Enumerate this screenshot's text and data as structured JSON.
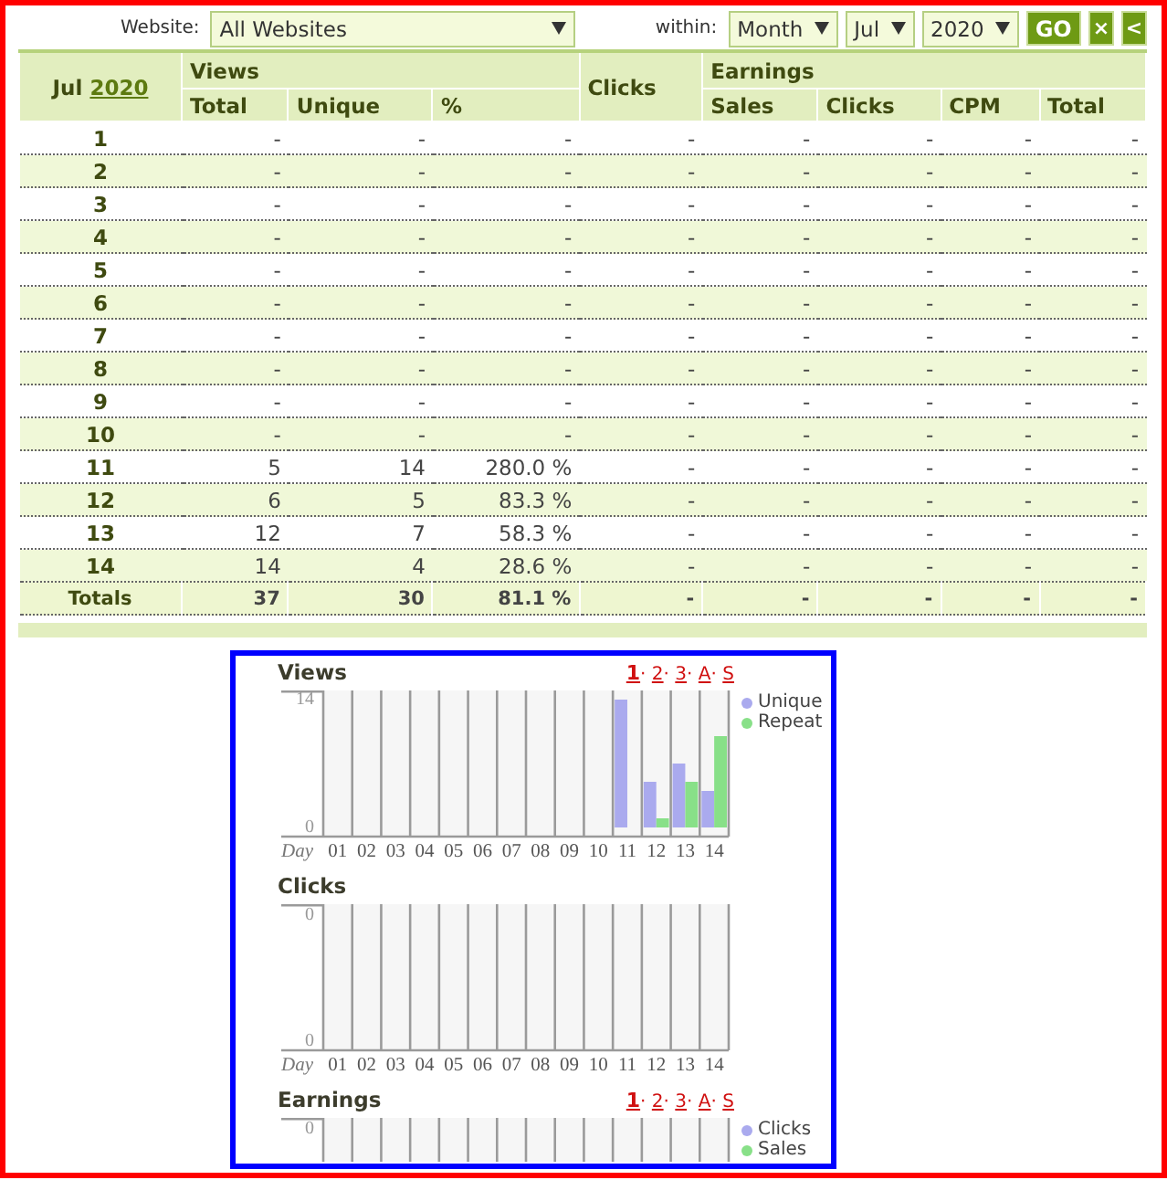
{
  "filters": {
    "website_label": "Website:",
    "website": "All Websites",
    "within_label": "within:",
    "period": "Month",
    "month": "Jul",
    "year": "2020",
    "buttons": [
      {
        "kind": "go",
        "label": "GO"
      },
      {
        "kind": "clear",
        "label": "×"
      },
      {
        "kind": "back",
        "label": "<"
      }
    ]
  },
  "table": {
    "month": "Jul",
    "year": "2020",
    "views": "Views",
    "clicks": "Clicks",
    "earnings": "Earnings",
    "views_columns": [
      "Total",
      "Unique",
      "%"
    ],
    "earnings_columns": [
      "Sales",
      "Clicks",
      "CPM",
      "Total"
    ],
    "rows": [
      {
        "day": "1",
        "cells": [
          "-",
          "-",
          "-",
          "-",
          "-",
          "-",
          "-",
          "-"
        ]
      },
      {
        "day": "2",
        "cells": [
          "-",
          "-",
          "-",
          "-",
          "-",
          "-",
          "-",
          "-"
        ]
      },
      {
        "day": "3",
        "cells": [
          "-",
          "-",
          "-",
          "-",
          "-",
          "-",
          "-",
          "-"
        ]
      },
      {
        "day": "4",
        "cells": [
          "-",
          "-",
          "-",
          "-",
          "-",
          "-",
          "-",
          "-"
        ]
      },
      {
        "day": "5",
        "cells": [
          "-",
          "-",
          "-",
          "-",
          "-",
          "-",
          "-",
          "-"
        ]
      },
      {
        "day": "6",
        "cells": [
          "-",
          "-",
          "-",
          "-",
          "-",
          "-",
          "-",
          "-"
        ]
      },
      {
        "day": "7",
        "cells": [
          "-",
          "-",
          "-",
          "-",
          "-",
          "-",
          "-",
          "-"
        ]
      },
      {
        "day": "8",
        "cells": [
          "-",
          "-",
          "-",
          "-",
          "-",
          "-",
          "-",
          "-"
        ]
      },
      {
        "day": "9",
        "cells": [
          "-",
          "-",
          "-",
          "-",
          "-",
          "-",
          "-",
          "-"
        ]
      },
      {
        "day": "10",
        "cells": [
          "-",
          "-",
          "-",
          "-",
          "-",
          "-",
          "-",
          "-"
        ]
      },
      {
        "day": "11",
        "cells": [
          "5",
          "14",
          "280.0 %",
          "-",
          "-",
          "-",
          "-",
          "-"
        ]
      },
      {
        "day": "12",
        "cells": [
          "6",
          "5",
          "83.3 %",
          "-",
          "-",
          "-",
          "-",
          "-"
        ]
      },
      {
        "day": "13",
        "cells": [
          "12",
          "7",
          "58.3 %",
          "-",
          "-",
          "-",
          "-",
          "-"
        ]
      },
      {
        "day": "14",
        "cells": [
          "14",
          "4",
          "28.6 %",
          "-",
          "-",
          "-",
          "-",
          "-"
        ]
      }
    ],
    "totals": {
      "label": "Totals",
      "cells": [
        "37",
        "30",
        "81.1 %",
        "-",
        "-",
        "-",
        "-",
        "-"
      ]
    }
  },
  "charts": [
    {
      "kind": "full",
      "separator": "·",
      "links": [
        {
          "label": "1",
          "selected": true
        },
        {
          "label": "2",
          "selected": false
        },
        {
          "label": "3",
          "selected": false
        },
        {
          "label": "A",
          "selected": false
        },
        {
          "label": "S",
          "selected": false
        }
      ],
      "chart_data": {
        "type": "bar",
        "title": "Views",
        "xlabel": "Day",
        "categories": [
          "01",
          "02",
          "03",
          "04",
          "05",
          "06",
          "07",
          "08",
          "09",
          "10",
          "11",
          "12",
          "13",
          "14"
        ],
        "ylim": [
          0,
          14
        ],
        "yticks": [
          0,
          14
        ],
        "legend": "right",
        "series": [
          {
            "name": "Unique",
            "color": "#aaaaee",
            "values": [
              0,
              0,
              0,
              0,
              0,
              0,
              0,
              0,
              0,
              0,
              14,
              5,
              7,
              4
            ]
          },
          {
            "name": "Repeat",
            "color": "#88e088",
            "values": [
              0,
              0,
              0,
              0,
              0,
              0,
              0,
              0,
              0,
              0,
              0,
              1,
              5,
              10
            ]
          }
        ]
      }
    },
    {
      "kind": "full",
      "title": "Clicks",
      "y_labels": [
        "0",
        "0"
      ],
      "xlabel": "Day",
      "categories": [
        "01",
        "02",
        "03",
        "04",
        "05",
        "06",
        "07",
        "08",
        "09",
        "10",
        "11",
        "12",
        "13",
        "14"
      ]
    },
    {
      "kind": "top",
      "separator": "·",
      "links": [
        {
          "label": "1",
          "selected": true
        },
        {
          "label": "2",
          "selected": false
        },
        {
          "label": "3",
          "selected": false
        },
        {
          "label": "A",
          "selected": false
        },
        {
          "label": "S",
          "selected": false
        }
      ],
      "y_labels": [
        "0"
      ],
      "title": "Earnings",
      "legend": [
        {
          "name": "Clicks",
          "color": "#aaaaee"
        },
        {
          "name": "Sales",
          "color": "#88e088"
        }
      ]
    }
  ]
}
